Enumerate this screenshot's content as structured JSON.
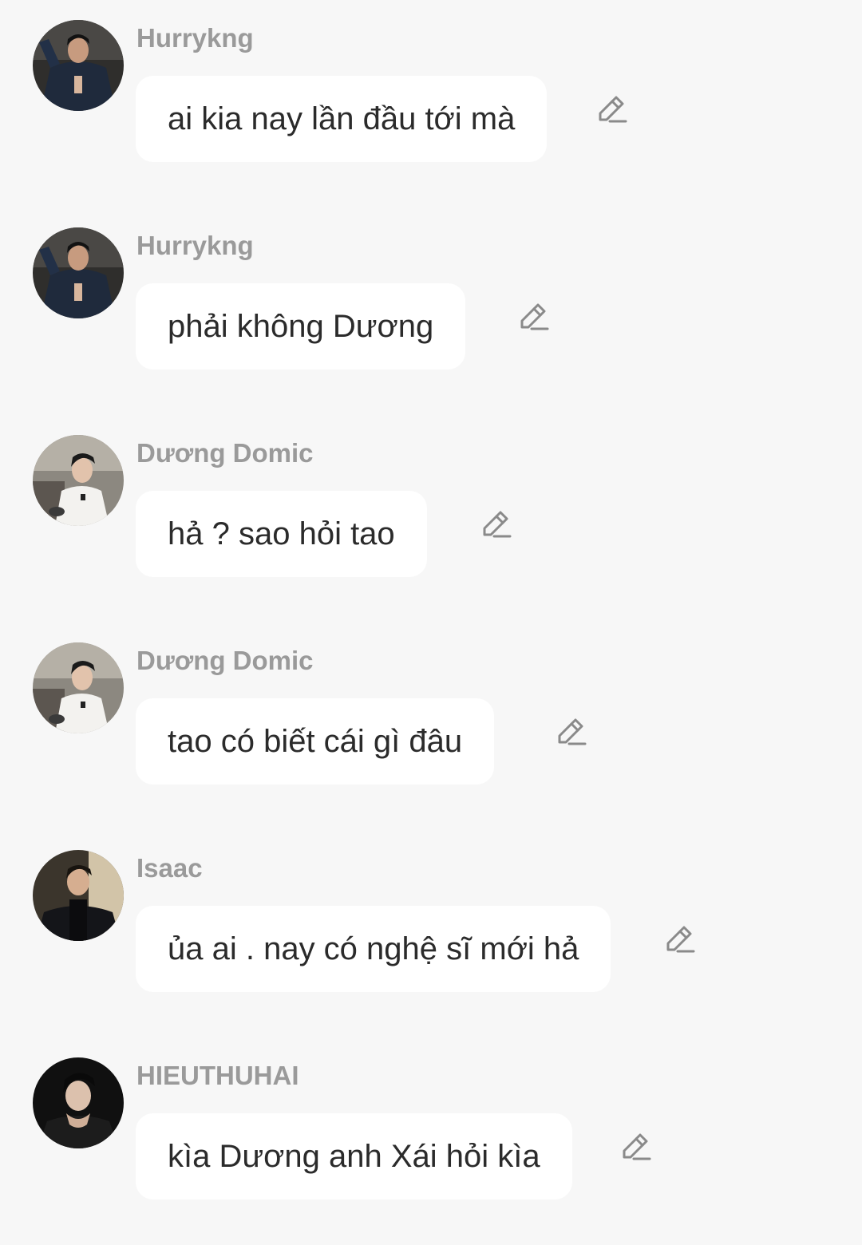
{
  "messages": [
    {
      "sender": "Hurrykng",
      "text": "ai kia nay lần đầu tới mà",
      "avatar": "hurrykng"
    },
    {
      "sender": "Hurrykng",
      "text": "phải không Dương",
      "avatar": "hurrykng"
    },
    {
      "sender": "Dương Domic",
      "text": "hả ? sao hỏi tao",
      "avatar": "duong"
    },
    {
      "sender": "Dương Domic",
      "text": "tao có biết cái gì đâu",
      "avatar": "duong"
    },
    {
      "sender": "Isaac",
      "text": "ủa ai . nay có nghệ sĩ mới hả",
      "avatar": "isaac"
    },
    {
      "sender": "HIEUTHUHAI",
      "text": "kìa Dương anh Xái hỏi kìa",
      "avatar": "hieuthuhai"
    }
  ],
  "icons": {
    "edit": "edit-pencil-icon"
  },
  "colors": {
    "background": "#f7f7f7",
    "bubble": "#ffffff",
    "sender_name": "#9a9a9a",
    "message_text": "#2b2b2b",
    "icon": "#8a8a8a"
  }
}
